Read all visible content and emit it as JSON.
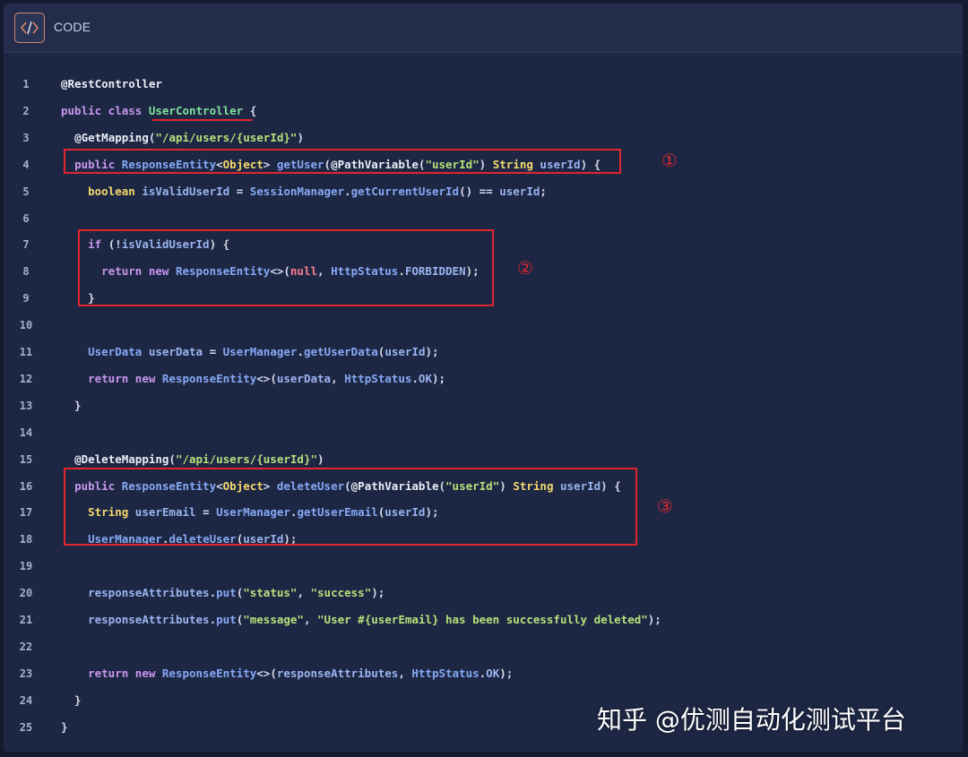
{
  "header": {
    "title": "CODE",
    "icon": "code-icon"
  },
  "lines": [
    {
      "n": "1",
      "tokens": [
        [
          "an",
          "@RestController"
        ]
      ]
    },
    {
      "n": "2",
      "tokens": [
        [
          "kw",
          "public class "
        ],
        [
          "hl",
          "UserController"
        ],
        [
          "pu",
          " {"
        ]
      ]
    },
    {
      "n": "3",
      "tokens": [
        [
          "pu",
          "  "
        ],
        [
          "an",
          "@GetMapping"
        ],
        [
          "pu",
          "("
        ],
        [
          "st",
          "\"/api/users/{userId}\""
        ],
        [
          "pu",
          ")"
        ]
      ]
    },
    {
      "n": "4",
      "tokens": [
        [
          "pu",
          "  "
        ],
        [
          "kw",
          "public "
        ],
        [
          "ty",
          "ResponseEntity"
        ],
        [
          "pu",
          "<"
        ],
        [
          "cl",
          "Object"
        ],
        [
          "pu",
          "> "
        ],
        [
          "fn",
          "getUser"
        ],
        [
          "pu",
          "("
        ],
        [
          "an",
          "@PathVariable"
        ],
        [
          "pu",
          "("
        ],
        [
          "st",
          "\"userId\""
        ],
        [
          "pu",
          ") "
        ],
        [
          "cl",
          "String"
        ],
        [
          "pu",
          " "
        ],
        [
          "vr",
          "userId"
        ],
        [
          "pu",
          ") {"
        ]
      ]
    },
    {
      "n": "5",
      "tokens": [
        [
          "pu",
          "    "
        ],
        [
          "cl",
          "boolean"
        ],
        [
          "pu",
          " "
        ],
        [
          "vr",
          "isValidUserId"
        ],
        [
          "pu",
          " = "
        ],
        [
          "ty",
          "SessionManager"
        ],
        [
          "pu",
          "."
        ],
        [
          "fn",
          "getCurrentUserId"
        ],
        [
          "pu",
          "() == "
        ],
        [
          "vr",
          "userId"
        ],
        [
          "pu",
          ";"
        ]
      ]
    },
    {
      "n": "6",
      "tokens": []
    },
    {
      "n": "7",
      "tokens": [
        [
          "pu",
          "    "
        ],
        [
          "kw",
          "if"
        ],
        [
          "pu",
          " (!"
        ],
        [
          "vr",
          "isValidUserId"
        ],
        [
          "pu",
          ") {"
        ]
      ]
    },
    {
      "n": "8",
      "tokens": [
        [
          "pu",
          "      "
        ],
        [
          "kw",
          "return new "
        ],
        [
          "ty",
          "ResponseEntity"
        ],
        [
          "pu",
          "<>("
        ],
        [
          "nl",
          "null"
        ],
        [
          "pu",
          ", "
        ],
        [
          "ty",
          "HttpStatus"
        ],
        [
          "pu",
          "."
        ],
        [
          "vr",
          "FORBIDDEN"
        ],
        [
          "pu",
          ");"
        ]
      ]
    },
    {
      "n": "9",
      "tokens": [
        [
          "pu",
          "    }"
        ]
      ]
    },
    {
      "n": "10",
      "tokens": []
    },
    {
      "n": "11",
      "tokens": [
        [
          "pu",
          "    "
        ],
        [
          "ty",
          "UserData"
        ],
        [
          "pu",
          " "
        ],
        [
          "vr",
          "userData"
        ],
        [
          "pu",
          " = "
        ],
        [
          "ty",
          "UserManager"
        ],
        [
          "pu",
          "."
        ],
        [
          "fn",
          "getUserData"
        ],
        [
          "pu",
          "("
        ],
        [
          "vr",
          "userId"
        ],
        [
          "pu",
          ");"
        ]
      ]
    },
    {
      "n": "12",
      "tokens": [
        [
          "pu",
          "    "
        ],
        [
          "kw",
          "return new "
        ],
        [
          "ty",
          "ResponseEntity"
        ],
        [
          "pu",
          "<>("
        ],
        [
          "vr",
          "userData"
        ],
        [
          "pu",
          ", "
        ],
        [
          "ty",
          "HttpStatus"
        ],
        [
          "pu",
          "."
        ],
        [
          "vr",
          "OK"
        ],
        [
          "pu",
          ");"
        ]
      ]
    },
    {
      "n": "13",
      "tokens": [
        [
          "pu",
          "  }"
        ]
      ]
    },
    {
      "n": "14",
      "tokens": []
    },
    {
      "n": "15",
      "tokens": [
        [
          "pu",
          "  "
        ],
        [
          "an",
          "@DeleteMapping"
        ],
        [
          "pu",
          "("
        ],
        [
          "st",
          "\"/api/users/{userId}\""
        ],
        [
          "pu",
          ")"
        ]
      ]
    },
    {
      "n": "16",
      "tokens": [
        [
          "pu",
          "  "
        ],
        [
          "kw",
          "public "
        ],
        [
          "ty",
          "ResponseEntity"
        ],
        [
          "pu",
          "<"
        ],
        [
          "cl",
          "Object"
        ],
        [
          "pu",
          "> "
        ],
        [
          "fn",
          "deleteUser"
        ],
        [
          "pu",
          "("
        ],
        [
          "an",
          "@PathVariable"
        ],
        [
          "pu",
          "("
        ],
        [
          "st",
          "\"userId\""
        ],
        [
          "pu",
          ") "
        ],
        [
          "cl",
          "String"
        ],
        [
          "pu",
          " "
        ],
        [
          "vr",
          "userId"
        ],
        [
          "pu",
          ") {"
        ]
      ]
    },
    {
      "n": "17",
      "tokens": [
        [
          "pu",
          "    "
        ],
        [
          "cl",
          "String"
        ],
        [
          "pu",
          " "
        ],
        [
          "vr",
          "userEmail"
        ],
        [
          "pu",
          " = "
        ],
        [
          "ty",
          "UserManager"
        ],
        [
          "pu",
          "."
        ],
        [
          "fn",
          "getUserEmail"
        ],
        [
          "pu",
          "("
        ],
        [
          "vr",
          "userId"
        ],
        [
          "pu",
          ");"
        ]
      ]
    },
    {
      "n": "18",
      "tokens": [
        [
          "pu",
          "    "
        ],
        [
          "ty",
          "UserManager"
        ],
        [
          "pu",
          "."
        ],
        [
          "fn",
          "deleteUser"
        ],
        [
          "pu",
          "("
        ],
        [
          "vr",
          "userId"
        ],
        [
          "pu",
          ");"
        ]
      ]
    },
    {
      "n": "19",
      "tokens": []
    },
    {
      "n": "20",
      "tokens": [
        [
          "pu",
          "    "
        ],
        [
          "vr",
          "responseAttributes"
        ],
        [
          "pu",
          "."
        ],
        [
          "fn",
          "put"
        ],
        [
          "pu",
          "("
        ],
        [
          "st",
          "\"status\""
        ],
        [
          "pu",
          ", "
        ],
        [
          "st",
          "\"success\""
        ],
        [
          "pu",
          ");"
        ]
      ]
    },
    {
      "n": "21",
      "tokens": [
        [
          "pu",
          "    "
        ],
        [
          "vr",
          "responseAttributes"
        ],
        [
          "pu",
          "."
        ],
        [
          "fn",
          "put"
        ],
        [
          "pu",
          "("
        ],
        [
          "st",
          "\"message\""
        ],
        [
          "pu",
          ", "
        ],
        [
          "st",
          "\"User #{userEmail} has been successfully deleted\""
        ],
        [
          "pu",
          ");"
        ]
      ]
    },
    {
      "n": "22",
      "tokens": []
    },
    {
      "n": "23",
      "tokens": [
        [
          "pu",
          "    "
        ],
        [
          "kw",
          "return new "
        ],
        [
          "ty",
          "ResponseEntity"
        ],
        [
          "pu",
          "<>("
        ],
        [
          "vr",
          "responseAttributes"
        ],
        [
          "pu",
          ", "
        ],
        [
          "ty",
          "HttpStatus"
        ],
        [
          "pu",
          "."
        ],
        [
          "vr",
          "OK"
        ],
        [
          "pu",
          ");"
        ]
      ]
    },
    {
      "n": "24",
      "tokens": [
        [
          "pu",
          "  }"
        ]
      ]
    },
    {
      "n": "25",
      "tokens": [
        [
          "pu",
          "}"
        ]
      ]
    }
  ],
  "markers": {
    "m1": "①",
    "m2": "②",
    "m3": "③"
  },
  "watermark": "知乎 @优测自动化测试平台",
  "colors": {
    "background": "#1d2744",
    "header": "#232d4b",
    "keyword": "#c796ec",
    "type": "#86a9f4",
    "string": "#b5e07a",
    "class": "#f4d96c",
    "annotation_red": "#e0262e"
  }
}
